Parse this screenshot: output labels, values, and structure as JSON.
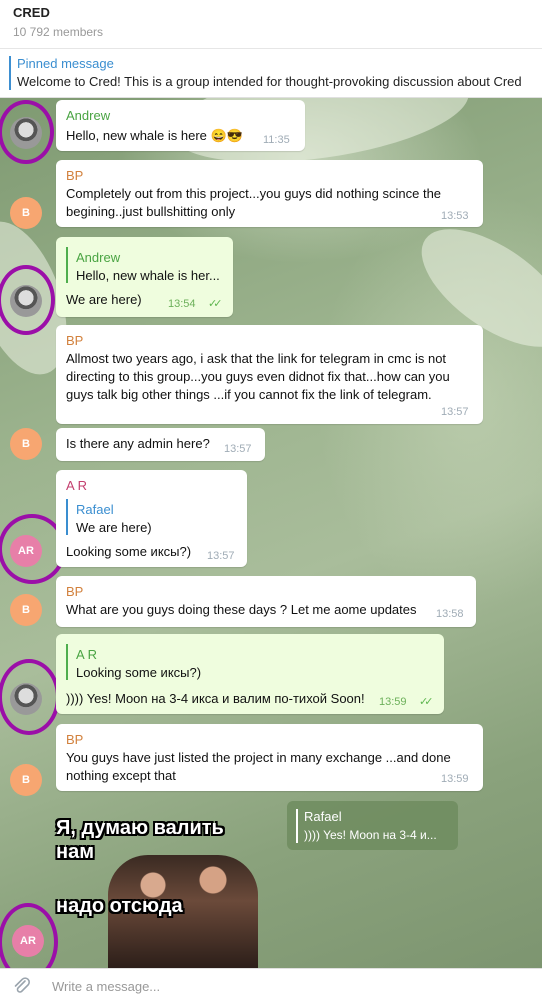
{
  "header": {
    "title": "CRED",
    "members": "10 792 members"
  },
  "pinned": {
    "label": "Pinned message",
    "text": "Welcome to Cred!  This is a group intended for thought-provoking discussion about Cred"
  },
  "messages": [
    {
      "sender": "Andrew",
      "text": "Hello, new whale is here 😄😎",
      "time": "11:35"
    },
    {
      "sender": "BP",
      "avatar": "B",
      "text": "Completely out from this project...you guys did nothing scince the begining..just bullshitting only",
      "line1": "Completely out from this project...you guys did nothing scince the",
      "line2": "begining..just bullshitting only",
      "time": "13:53"
    },
    {
      "reply_name": "Andrew",
      "reply_text": "Hello, new whale is her...",
      "text": "We are here)",
      "time": "13:54"
    },
    {
      "sender": "BP",
      "line1": "Allmost two years ago, i ask that the link for  telegram in cmc is not",
      "line2": "directing to this group...you guys even didnot fix that...how can you",
      "line3": "guys talk big other things ...if you cannot fix the link of telegram.",
      "time": "13:57"
    },
    {
      "avatar": "B",
      "text": "Is there any admin here?",
      "time": "13:57"
    },
    {
      "sender": "A R",
      "reply_name": "Rafael",
      "reply_text": "We are here)",
      "text": "Looking some иксы?)",
      "time": "13:57",
      "avatar": "AR"
    },
    {
      "sender": "BP",
      "avatar": "B",
      "text": "What are you guys doing these days ? Let me aome updates",
      "time": "13:58"
    },
    {
      "reply_name": "A R",
      "reply_text": "Looking some иксы?)",
      "text": ")))) Yes! Moon на 3-4 икса и валим по-тихой Soon!",
      "time": "13:59"
    },
    {
      "sender": "BP",
      "avatar": "B",
      "line1": "You guys have just listed the project in many exchange ...and done",
      "line2": "nothing except that",
      "time": "13:59"
    }
  ],
  "sticker": {
    "line1": "Я, думаю валить",
    "line2": "нам",
    "line3": "надо отсюда",
    "reply_name": "Rafael",
    "reply_text": ")))) Yes! Moon на 3-4 и...",
    "avatar": "AR"
  },
  "input": {
    "placeholder": "Write a message..."
  },
  "colors": {
    "accent": "#3a8ed0",
    "bp_name": "#d2813d",
    "ar_name": "#c4406f",
    "green_name": "#4aa443",
    "annotation": "#9b0fa8"
  },
  "icons": {
    "attach": "paperclip-icon",
    "read": "double-check-icon"
  }
}
